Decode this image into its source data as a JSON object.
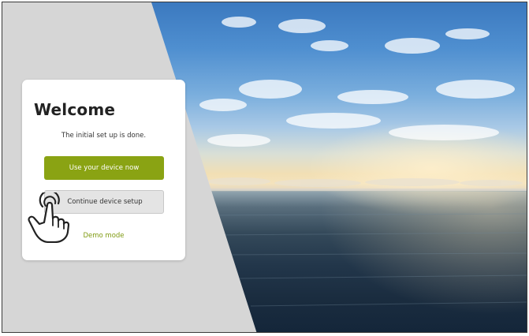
{
  "welcome": {
    "title": "Welcome",
    "subtitle": "The initial set up is done.",
    "primary_button": "Use your device now",
    "secondary_button": "Continue device setup",
    "demo_link": "Demo mode"
  },
  "icons": {
    "hand": "touch-hand-icon"
  },
  "colors": {
    "primary": "#8aa313",
    "link": "#7f9a10",
    "left_panel": "#d6d6d6"
  }
}
